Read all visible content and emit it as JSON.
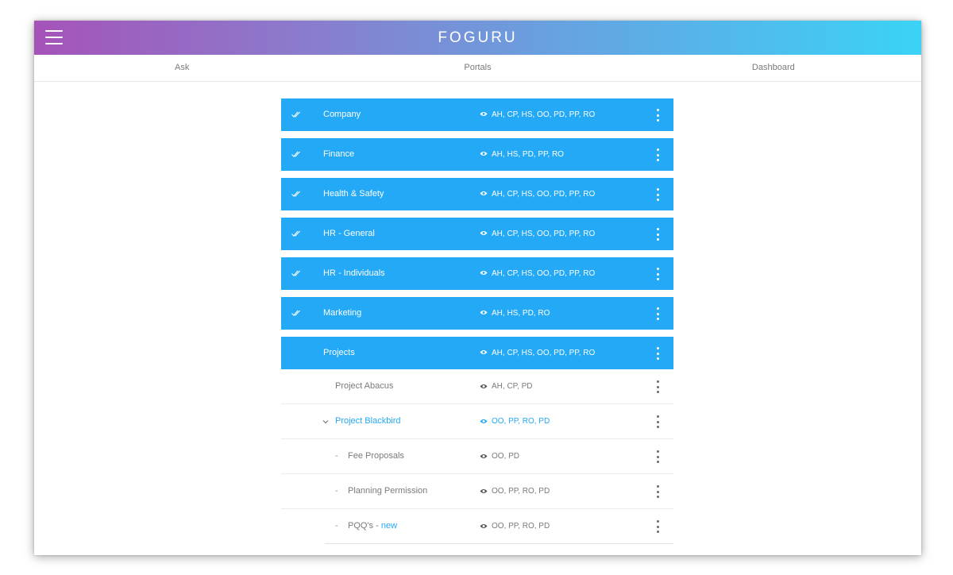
{
  "app": {
    "title": "FOGURU"
  },
  "tabs": [
    {
      "label": "Ask"
    },
    {
      "label": "Portals"
    },
    {
      "label": "Dashboard"
    }
  ],
  "portals": [
    {
      "name": "Company",
      "roles": "AH, CP, HS, OO, PD, PP, RO",
      "checked": true
    },
    {
      "name": "Finance",
      "roles": "AH, HS, PD, PP, RO",
      "checked": true
    },
    {
      "name": "Health & Safety",
      "roles": "AH, CP, HS, OO, PD, PP, RO",
      "checked": true
    },
    {
      "name": "HR - General",
      "roles": "AH, CP, HS, OO, PD, PP, RO",
      "checked": true
    },
    {
      "name": "HR - Individuals",
      "roles": "AH, CP, HS, OO, PD, PP, RO",
      "checked": true
    },
    {
      "name": "Marketing",
      "roles": "AH, HS, PD, RO",
      "checked": true
    },
    {
      "name": "Projects",
      "roles": "AH, CP, HS, OO, PD, PP, RO",
      "checked": false
    }
  ],
  "projects": {
    "abacus": {
      "name": "Project Abacus",
      "roles": "AH, CP, PD"
    },
    "blackbird": {
      "name": "Project Blackbird",
      "roles": "OO, PP, RO, PD",
      "expanded": true
    },
    "children": [
      {
        "dash": "-",
        "name": "Fee Proposals",
        "roles": "OO, PD"
      },
      {
        "dash": "-",
        "name": "Planning Permission",
        "roles": "OO, PP, RO, PD"
      },
      {
        "dash": "-",
        "name": "PQQ's",
        "separator": " - ",
        "tag": "new",
        "roles": "OO, PP, RO, PD"
      }
    ]
  },
  "colors": {
    "accent": "#23a9f6",
    "header_gradient": [
      "#a553b9",
      "#3ad3f6"
    ],
    "muted_text": "#7a7a7a"
  },
  "icons": {
    "menu": "hamburger-icon",
    "check": "double-check-icon",
    "eye": "eye-icon",
    "more": "more-vertical-icon",
    "chevron": "chevron-down-icon"
  }
}
